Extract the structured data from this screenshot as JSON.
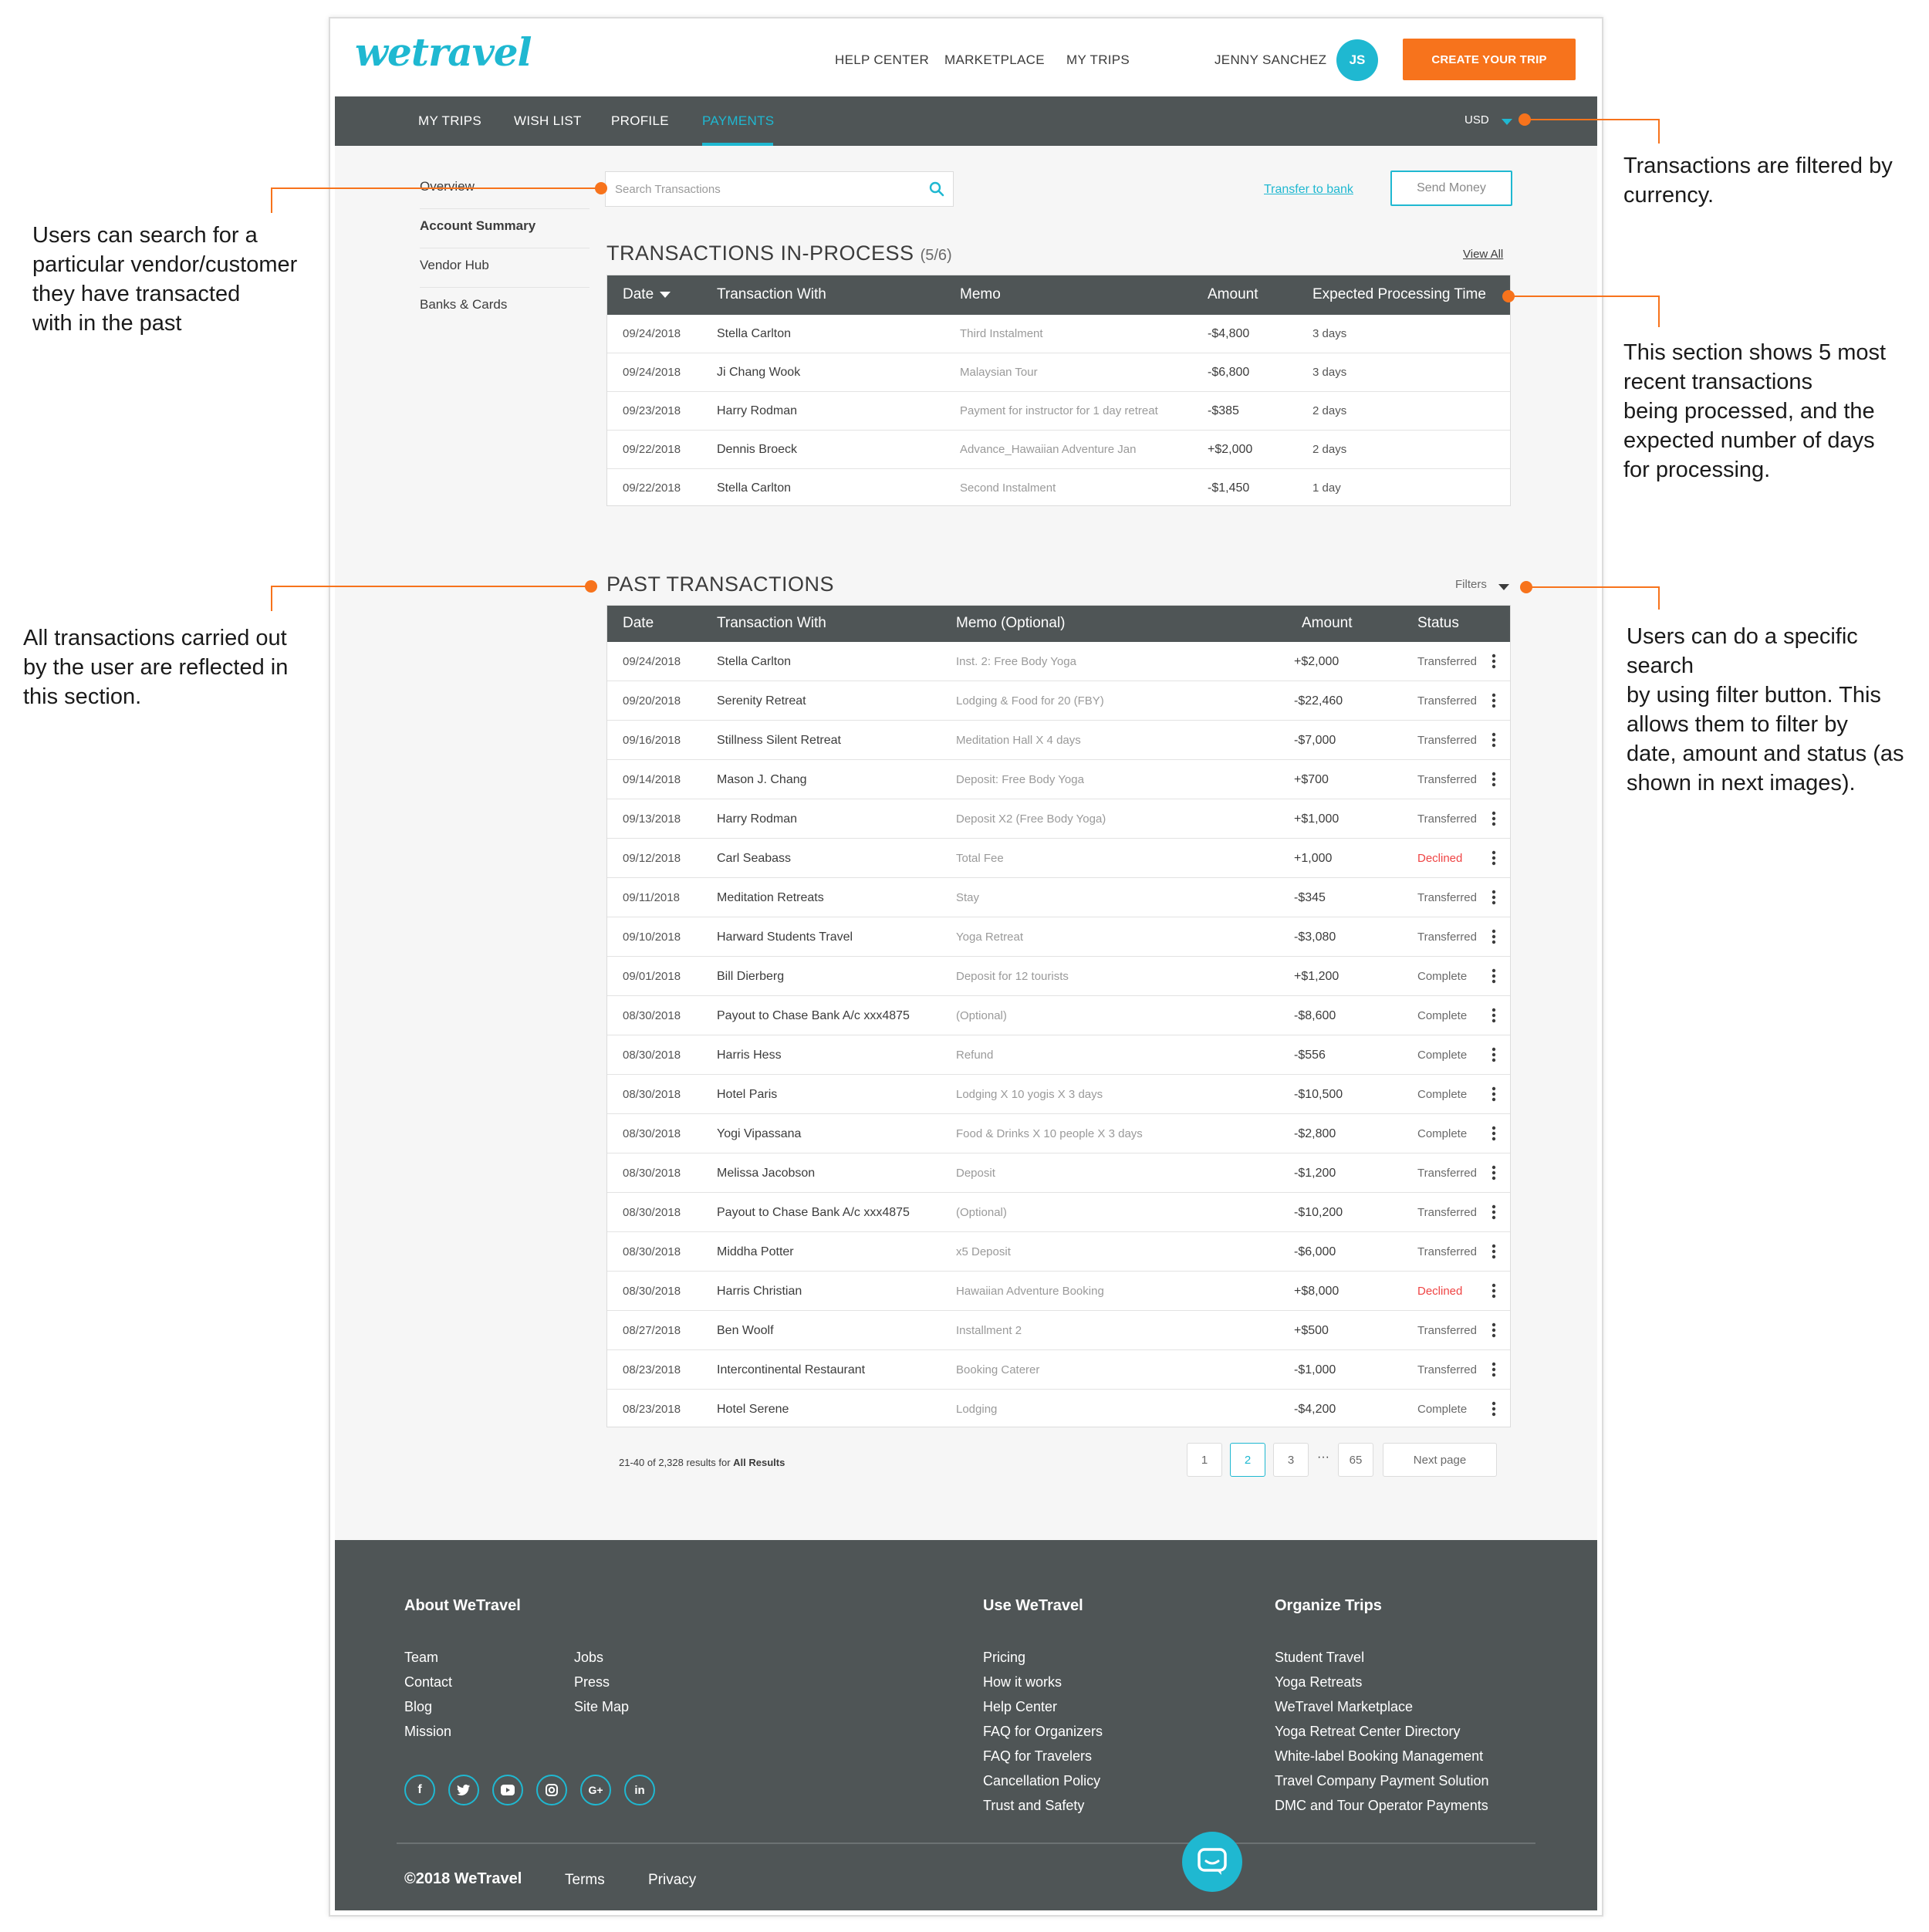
{
  "header": {
    "logo": "wetravel",
    "nav": [
      "HELP CENTER",
      "MARKETPLACE",
      "MY TRIPS"
    ],
    "user_name": "JENNY SANCHEZ",
    "user_initials": "JS",
    "create_trip": "CREATE YOUR TRIP"
  },
  "subnav": {
    "tabs": [
      "MY TRIPS",
      "WISH LIST",
      "PROFILE",
      "PAYMENTS"
    ],
    "active_tab": "PAYMENTS",
    "currency": "USD"
  },
  "sidebar": {
    "items": [
      "Overview",
      "Account Summary",
      "Vendor Hub",
      "Banks & Cards"
    ]
  },
  "toolbar": {
    "search_placeholder": "Search Transactions",
    "transfer_link": "Transfer to bank",
    "send_money": "Send Money"
  },
  "in_process": {
    "title": "TRANSACTIONS  IN-PROCESS",
    "count": "(5/6)",
    "view_all": "View All",
    "headers": [
      "Date",
      "Transaction With",
      "Memo",
      "Amount",
      "Expected Processing Time"
    ],
    "rows": [
      {
        "date": "09/24/2018",
        "name": "Stella Carlton",
        "memo": "Third Instalment",
        "amount": "-$4,800",
        "time": "3 days"
      },
      {
        "date": "09/24/2018",
        "name": "Ji Chang Wook",
        "memo": "Malaysian Tour",
        "amount": "-$6,800",
        "time": "3 days"
      },
      {
        "date": "09/23/2018",
        "name": "Harry Rodman",
        "memo": "Payment for instructor for 1 day retreat",
        "amount": "-$385",
        "time": "2 days"
      },
      {
        "date": "09/22/2018",
        "name": "Dennis Broeck",
        "memo": "Advance_Hawaiian Adventure Jan",
        "amount": "+$2,000",
        "time": "2 days"
      },
      {
        "date": "09/22/2018",
        "name": "Stella Carlton",
        "memo": "Second Instalment",
        "amount": "-$1,450",
        "time": "1 day"
      }
    ]
  },
  "past": {
    "title": "PAST TRANSACTIONS",
    "filters": "Filters",
    "headers": [
      "Date",
      "Transaction With",
      "Memo (Optional)",
      "Amount",
      "Status"
    ],
    "rows": [
      {
        "date": "09/24/2018",
        "name": "Stella Carlton",
        "memo": "Inst. 2: Free Body Yoga",
        "amount": "+$2,000",
        "status": "Transferred"
      },
      {
        "date": "09/20/2018",
        "name": "Serenity Retreat",
        "memo": "Lodging & Food for 20 (FBY)",
        "amount": "-$22,460",
        "status": "Transferred"
      },
      {
        "date": "09/16/2018",
        "name": "Stillness Silent Retreat",
        "memo": "Meditation Hall X 4 days",
        "amount": "-$7,000",
        "status": "Transferred"
      },
      {
        "date": "09/14/2018",
        "name": "Mason J. Chang",
        "memo": "Deposit: Free Body Yoga",
        "amount": "+$700",
        "status": "Transferred"
      },
      {
        "date": "09/13/2018",
        "name": "Harry Rodman",
        "memo": "Deposit X2 (Free Body Yoga)",
        "amount": "+$1,000",
        "status": "Transferred"
      },
      {
        "date": "09/12/2018",
        "name": "Carl Seabass",
        "memo": "Total Fee",
        "amount": "+1,000",
        "status": "Declined"
      },
      {
        "date": "09/11/2018",
        "name": "Meditation Retreats",
        "memo": "Stay",
        "amount": "-$345",
        "status": "Transferred"
      },
      {
        "date": "09/10/2018",
        "name": "Harward Students Travel",
        "memo": "Yoga Retreat",
        "amount": "-$3,080",
        "status": "Transferred"
      },
      {
        "date": "09/01/2018",
        "name": "Bill Dierberg",
        "memo": "Deposit for 12 tourists",
        "amount": "+$1,200",
        "status": "Complete"
      },
      {
        "date": "08/30/2018",
        "name": "Payout to Chase Bank A/c xxx4875",
        "memo": "(Optional)",
        "amount": "-$8,600",
        "status": "Complete"
      },
      {
        "date": "08/30/2018",
        "name": "Harris Hess",
        "memo": "Refund",
        "amount": "-$556",
        "status": "Complete"
      },
      {
        "date": "08/30/2018",
        "name": "Hotel Paris",
        "memo": "Lodging X 10 yogis X 3 days",
        "amount": "-$10,500",
        "status": "Complete"
      },
      {
        "date": "08/30/2018",
        "name": "Yogi Vipassana",
        "memo": "Food & Drinks X 10 people X 3 days",
        "amount": "-$2,800",
        "status": "Complete"
      },
      {
        "date": "08/30/2018",
        "name": "Melissa Jacobson",
        "memo": "Deposit",
        "amount": "-$1,200",
        "status": "Transferred"
      },
      {
        "date": "08/30/2018",
        "name": "Payout to Chase Bank A/c xxx4875",
        "memo": "(Optional)",
        "amount": "-$10,200",
        "status": "Transferred"
      },
      {
        "date": "08/30/2018",
        "name": "Middha Potter",
        "memo": "x5 Deposit",
        "amount": "-$6,000",
        "status": "Transferred"
      },
      {
        "date": "08/30/2018",
        "name": "Harris Christian",
        "memo": "Hawaiian Adventure Booking",
        "amount": "+$8,000",
        "status": "Declined"
      },
      {
        "date": "08/27/2018",
        "name": "Ben Woolf",
        "memo": "Installment 2",
        "amount": "+$500",
        "status": "Transferred"
      },
      {
        "date": "08/23/2018",
        "name": "Intercontinental Restaurant",
        "memo": "Booking Caterer",
        "amount": "-$1,000",
        "status": "Transferred"
      },
      {
        "date": "08/23/2018",
        "name": "Hotel Serene",
        "memo": "Lodging",
        "amount": "-$4,200",
        "status": "Complete"
      }
    ]
  },
  "pagination": {
    "results_prefix": "21-40 of 2,328 results for ",
    "results_scope": "All Results",
    "pages": [
      "1",
      "2",
      "3",
      "65"
    ],
    "current": "2",
    "ellipsis": "···",
    "next": "Next page"
  },
  "footer": {
    "about_title": "About WeTravel",
    "about_col1": [
      "Team",
      "Contact",
      "Blog",
      "Mission"
    ],
    "about_col2": [
      "Jobs",
      "Press",
      "Site Map"
    ],
    "use_title": "Use WeTravel",
    "use_links": [
      "Pricing",
      "How it works",
      "Help Center",
      "FAQ for Organizers",
      "FAQ for Travelers",
      "Cancellation Policy",
      "Trust and Safety"
    ],
    "organize_title": "Organize Trips",
    "organize_links": [
      "Student Travel",
      "Yoga Retreats",
      "WeTravel Marketplace",
      "Yoga Retreat Center Directory",
      "White-label Booking Management",
      "Travel Company Payment Solution",
      "DMC and Tour Operator Payments"
    ],
    "social": [
      "facebook-icon",
      "twitter-icon",
      "youtube-icon",
      "instagram-icon",
      "google-plus-icon",
      "linkedin-icon"
    ],
    "copyright": "©2018 WeTravel",
    "terms": "Terms",
    "privacy": "Privacy"
  },
  "annotations": {
    "currency_note": "Transactions are filtered by\ncurrency.",
    "search_note": "Users can search for a\nparticular vendor/customer\nthey have transacted\nwith in the past",
    "recent_note": "This section shows 5 most\nrecent transactions\nbeing processed, and the\nexpected number of days\nfor processing.",
    "past_note": "All transactions carried out\nby the user are reflected in\nthis section.",
    "filter_note": "Users can do a specific search\nby using filter button. This\nallows them to filter by\ndate, amount and status (as\nshown in next images)."
  },
  "colors": {
    "accent": "#1fb8d1",
    "cta": "#f7731c",
    "nav_dark": "#4f5556",
    "declined": "#ef4444",
    "annotation": "#f7731c"
  }
}
